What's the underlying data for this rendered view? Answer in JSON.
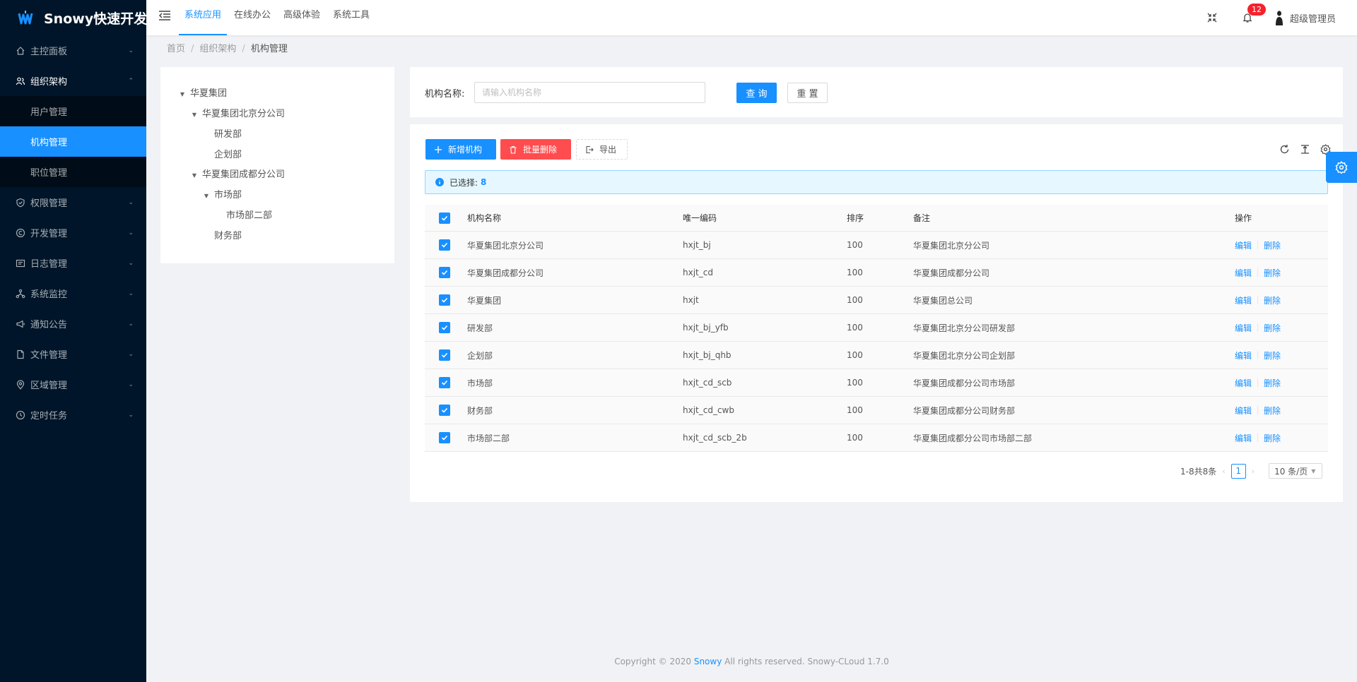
{
  "app": {
    "title": "Snowy快速开发..."
  },
  "sidebar": {
    "items": [
      {
        "label": "主控面板",
        "icon": "home-icon"
      },
      {
        "label": "组织架构",
        "icon": "team-icon"
      },
      {
        "label": "权限管理",
        "icon": "shield-icon"
      },
      {
        "label": "开发管理",
        "icon": "copyright-icon"
      },
      {
        "label": "日志管理",
        "icon": "log-icon"
      },
      {
        "label": "系统监控",
        "icon": "cluster-icon"
      },
      {
        "label": "通知公告",
        "icon": "notice-icon"
      },
      {
        "label": "文件管理",
        "icon": "file-icon"
      },
      {
        "label": "区域管理",
        "icon": "location-icon"
      },
      {
        "label": "定时任务",
        "icon": "timer-icon"
      }
    ],
    "submenu": [
      "用户管理",
      "机构管理",
      "职位管理"
    ]
  },
  "header": {
    "tabs": [
      "系统应用",
      "在线办公",
      "高级体验",
      "系统工具"
    ],
    "badge": "12",
    "username": "超级管理员"
  },
  "breadcrumb": {
    "items": [
      "首页",
      "组织架构",
      "机构管理"
    ]
  },
  "tree": {
    "nodes": [
      {
        "label": "华夏集团"
      },
      {
        "label": "华夏集团北京分公司"
      },
      {
        "label": "研发部"
      },
      {
        "label": "企划部"
      },
      {
        "label": "华夏集团成都分公司"
      },
      {
        "label": "市场部"
      },
      {
        "label": "市场部二部"
      },
      {
        "label": "财务部"
      }
    ]
  },
  "search": {
    "label": "机构名称:",
    "placeholder": "请输入机构名称",
    "query": "查 询",
    "reset": "重 置"
  },
  "toolbar": {
    "add": "新增机构",
    "batch_delete": "批量删除",
    "export": "导出"
  },
  "alert": {
    "label": "已选择:",
    "count": "8"
  },
  "table": {
    "columns": [
      "机构名称",
      "唯一编码",
      "排序",
      "备注",
      "操作"
    ],
    "rows": [
      {
        "name": "华夏集团北京分公司",
        "code": "hxjt_bj",
        "sort": "100",
        "remark": "华夏集团北京分公司"
      },
      {
        "name": "华夏集团成都分公司",
        "code": "hxjt_cd",
        "sort": "100",
        "remark": "华夏集团成都分公司"
      },
      {
        "name": "华夏集团",
        "code": "hxjt",
        "sort": "100",
        "remark": "华夏集团总公司"
      },
      {
        "name": "研发部",
        "code": "hxjt_bj_yfb",
        "sort": "100",
        "remark": "华夏集团北京分公司研发部"
      },
      {
        "name": "企划部",
        "code": "hxjt_bj_qhb",
        "sort": "100",
        "remark": "华夏集团北京分公司企划部"
      },
      {
        "name": "市场部",
        "code": "hxjt_cd_scb",
        "sort": "100",
        "remark": "华夏集团成都分公司市场部"
      },
      {
        "name": "财务部",
        "code": "hxjt_cd_cwb",
        "sort": "100",
        "remark": "华夏集团成都分公司财务部"
      },
      {
        "name": "市场部二部",
        "code": "hxjt_cd_scb_2b",
        "sort": "100",
        "remark": "华夏集团成都分公司市场部二部"
      }
    ],
    "edit": "编辑",
    "delete": "删除"
  },
  "pagination": {
    "total_text": "1-8共8条",
    "current": "1",
    "page_size": "10 条/页"
  },
  "footer": {
    "prefix": "Copyright © 2020",
    "brand": "Snowy",
    "suffix": "All rights reserved. Snowy-CLoud 1.7.0"
  },
  "colors": {
    "primary": "#1890ff",
    "danger": "#ff4d4f",
    "sidebar": "#001529",
    "badge": "#f5222d"
  }
}
